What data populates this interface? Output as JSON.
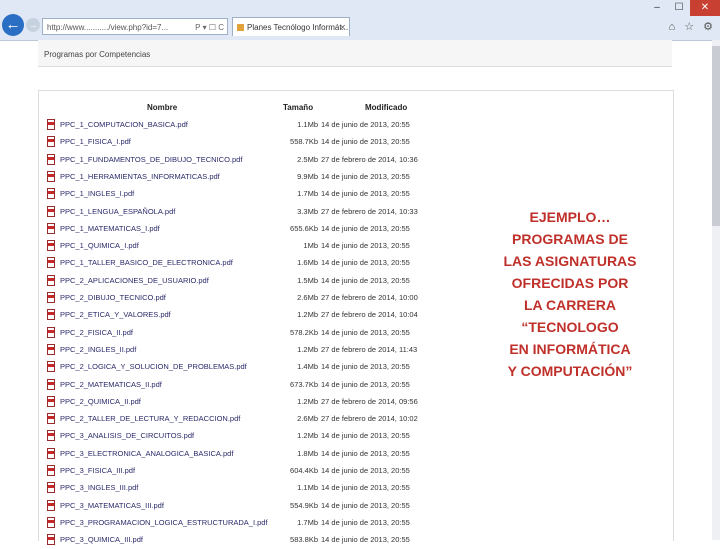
{
  "browser": {
    "url": "http://www.........../view.php?id=7...",
    "tab_title": "Planes Tecnólogo Informát...",
    "back_glyph": "←",
    "forward_glyph": "→",
    "address_controls": "P ▾ ☐ C",
    "tab_close": "✕",
    "min_glyph": "–",
    "max_glyph": "☐",
    "close_glyph": "✕",
    "toolbar_icons": "⌂ ☆ ⚙"
  },
  "page": {
    "header_title": "Programas por Competencias"
  },
  "listing": {
    "columns": {
      "name": "Nombre",
      "size": "Tamaño",
      "modified": "Modificado"
    },
    "files": [
      {
        "name": "PPC_1_COMPUTACION_BASICA.pdf",
        "size": "1.1Mb",
        "modified": "14 de junio de 2013, 20:55"
      },
      {
        "name": "PPC_1_FISICA_I.pdf",
        "size": "558.7Kb",
        "modified": "14 de junio de 2013, 20:55"
      },
      {
        "name": "PPC_1_FUNDAMENTOS_DE_DIBUJO_TECNICO.pdf",
        "size": "2.5Mb",
        "modified": "27 de febrero de 2014, 10:36"
      },
      {
        "name": "PPC_1_HERRAMIENTAS_INFORMATICAS.pdf",
        "size": "9.9Mb",
        "modified": "14 de junio de 2013, 20:55"
      },
      {
        "name": "PPC_1_INGLES_I.pdf",
        "size": "1.7Mb",
        "modified": "14 de junio de 2013, 20:55"
      },
      {
        "name": "PPC_1_LENGUA_ESPAÑOLA.pdf",
        "size": "3.3Mb",
        "modified": "27 de febrero de 2014, 10:33"
      },
      {
        "name": "PPC_1_MATEMATICAS_I.pdf",
        "size": "655.6Kb",
        "modified": "14 de junio de 2013, 20:55"
      },
      {
        "name": "PPC_1_QUIMICA_I.pdf",
        "size": "1Mb",
        "modified": "14 de junio de 2013, 20:55"
      },
      {
        "name": "PPC_1_TALLER_BASICO_DE_ELECTRONICA.pdf",
        "size": "1.6Mb",
        "modified": "14 de junio de 2013, 20:55"
      },
      {
        "name": "PPC_2_APLICACIONES_DE_USUARIO.pdf",
        "size": "1.5Mb",
        "modified": "14 de junio de 2013, 20:55"
      },
      {
        "name": "PPC_2_DIBUJO_TECNICO.pdf",
        "size": "2.6Mb",
        "modified": "27 de febrero de 2014, 10:00"
      },
      {
        "name": "PPC_2_ETICA_Y_VALORES.pdf",
        "size": "1.2Mb",
        "modified": "27 de febrero de 2014, 10:04"
      },
      {
        "name": "PPC_2_FISICA_II.pdf",
        "size": "578.2Kb",
        "modified": "14 de junio de 2013, 20:55"
      },
      {
        "name": "PPC_2_INGLES_II.pdf",
        "size": "1.2Mb",
        "modified": "27 de febrero de 2014, 11:43"
      },
      {
        "name": "PPC_2_LOGICA_Y_SOLUCION_DE_PROBLEMAS.pdf",
        "size": "1.4Mb",
        "modified": "14 de junio de 2013, 20:55"
      },
      {
        "name": "PPC_2_MATEMATICAS_II.pdf",
        "size": "673.7Kb",
        "modified": "14 de junio de 2013, 20:55"
      },
      {
        "name": "PPC_2_QUIMICA_II.pdf",
        "size": "1.2Mb",
        "modified": "27 de febrero de 2014, 09:56"
      },
      {
        "name": "PPC_2_TALLER_DE_LECTURA_Y_REDACCION.pdf",
        "size": "2.6Mb",
        "modified": "27 de febrero de 2014, 10:02"
      },
      {
        "name": "PPC_3_ANALISIS_DE_CIRCUITOS.pdf",
        "size": "1.2Mb",
        "modified": "14 de junio de 2013, 20:55"
      },
      {
        "name": "PPC_3_ELECTRONICA_ANALOGICA_BASICA.pdf",
        "size": "1.8Mb",
        "modified": "14 de junio de 2013, 20:55"
      },
      {
        "name": "PPC_3_FISICA_III.pdf",
        "size": "604.4Kb",
        "modified": "14 de junio de 2013, 20:55"
      },
      {
        "name": "PPC_3_INGLES_III.pdf",
        "size": "1.1Mb",
        "modified": "14 de junio de 2013, 20:55"
      },
      {
        "name": "PPC_3_MATEMATICAS_III.pdf",
        "size": "554.9Kb",
        "modified": "14 de junio de 2013, 20:55"
      },
      {
        "name": "PPC_3_PROGRAMACION_LOGICA_ESTRUCTURADA_I.pdf",
        "size": "1.7Mb",
        "modified": "14 de junio de 2013, 20:55"
      },
      {
        "name": "PPC_3_QUIMICA_III.pdf",
        "size": "583.8Kb",
        "modified": "14 de junio de 2013, 20:55"
      }
    ]
  },
  "caption": {
    "lines": [
      "EJEMPLO…",
      "PROGRAMAS DE",
      "LAS ASIGNATURAS",
      "OFRECIDAS POR",
      "LA CARRERA",
      "“TECNOLOGO",
      "EN INFORMÁTICA",
      "Y COMPUTACIÓN”"
    ]
  }
}
